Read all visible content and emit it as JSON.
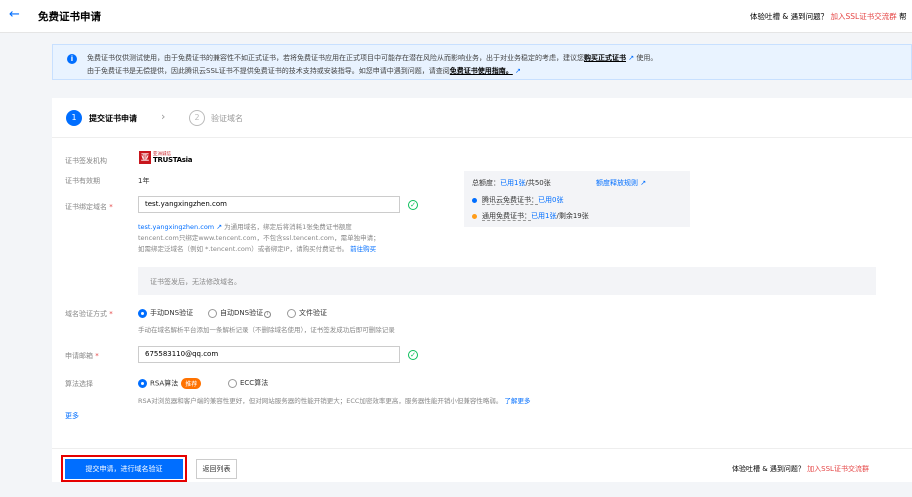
{
  "header": {
    "title": "免费证书申请",
    "help_text": "体验吐槽 & 遇到问题？",
    "help_link": "加入SSL证书交流群",
    "extra": "帮"
  },
  "notice": {
    "line1_pre": "免费证书仅供测试使用，由于免费证书的兼容性不如正式证书，若将免费证书应用在正式项目中可能存在潜在风险从而影响业务，出于对业务稳定的考虑，建议您",
    "line1_link": "购买正式证书",
    "line1_post": "使用。",
    "line2_pre": "由于免费证书是无偿提供，因此腾讯云SSL证书不提供免费证书的技术支持或安装指导。如您申请中遇到问题，请查阅",
    "line2_link": "免费证书使用指南。"
  },
  "steps": [
    {
      "num": "1",
      "label": "提交证书申请"
    },
    {
      "num": "2",
      "label": "验证域名"
    }
  ],
  "form": {
    "issuer_label": "证书签发机构",
    "logo_cn": "亚洲诚信",
    "logo_en": "TRUSTAsia",
    "validity_label": "证书有效期",
    "validity_value": "1年",
    "domain_label": "证书绑定域名",
    "domain_value": "test.yangxingzhen.com",
    "domain_hint_domain": "test.yangxingzhen.com",
    "domain_hint_1": "为通用域名，绑定后将消耗1张免费证书额度",
    "domain_hint_2": "tencent.com只绑定www.tencent.com，不包含ssl.tencent.com，需单独申请；",
    "domain_hint_3": "如需绑定泛域名（例如 *.tencent.com）或者绑定IP，请购买付费证书。",
    "domain_hint_link": "前往购买",
    "tip": "证书签发后，无法修改域名。",
    "verify_label": "域名验证方式",
    "verify_options": [
      "手动DNS验证",
      "自动DNS验证",
      "文件验证"
    ],
    "verify_hint": "手动在域名解析平台添加一条解析记录（不删除域名使用），证书签发成功后即可删除记录",
    "email_label": "申请邮箱",
    "email_value": "675583110@qq.com",
    "algo_label": "算法选择",
    "algo_options": [
      "RSA算法",
      "ECC算法"
    ],
    "algo_badge": "推荐",
    "algo_hint": "RSA对浏览器和客户端的兼容性更好，但对网站服务器的性能开销更大；ECC加密效率更高，服务器性能开销小但兼容性略弱。",
    "algo_hint_link": "了解更多",
    "more": "更多"
  },
  "quota": {
    "total_label": "总额度：",
    "total_used": "已用1张",
    "total_rest": "/共50张",
    "rule_link": "额度释放规则",
    "row1_label": "腾讯云免费证书：",
    "row1_used": "已用0张",
    "row2_label": "通用免费证书：",
    "row2_used": "已用1张",
    "row2_rest": "/剩余19张"
  },
  "footer": {
    "submit": "提交申请，进行域名验证",
    "back": "返回列表",
    "help_text": "体验吐槽 & 遇到问题？",
    "help_link": "加入SSL证书交流群"
  },
  "colors": {
    "primary": "#006eff",
    "success": "#0abf5b",
    "danger": "#e54545",
    "badge": "#ff7200"
  }
}
